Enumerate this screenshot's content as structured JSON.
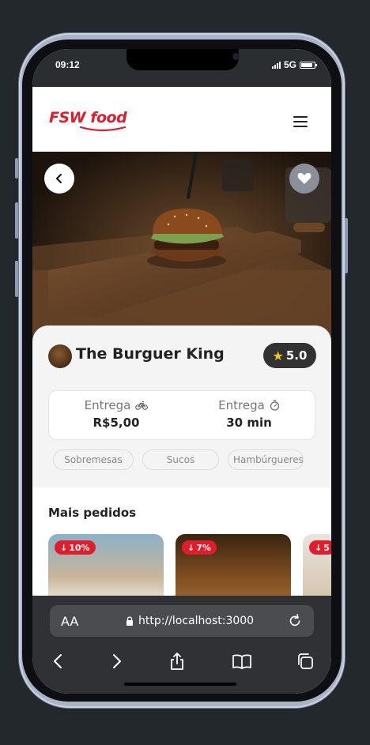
{
  "status": {
    "time": "09:12",
    "network": "5G"
  },
  "header": {
    "logo": "FSW food"
  },
  "restaurant": {
    "name": "The Burguer King",
    "rating": "5.0"
  },
  "delivery": {
    "fee_label": "Entrega",
    "fee_value": "R$5,00",
    "time_label": "Entrega",
    "time_value": "30 min"
  },
  "categories": [
    "Sobremesas",
    "Sucos",
    "Hambúrgueres"
  ],
  "section": {
    "title": "Mais pedidos"
  },
  "products": [
    {
      "discount": "10%"
    },
    {
      "discount": "7%"
    },
    {
      "discount": "5"
    }
  ],
  "browser": {
    "aa": "AA",
    "url": "http://localhost:3000"
  },
  "colors": {
    "brand": "#e11d2c",
    "rating_bg": "#323232",
    "browser_bg": "#2f3134"
  }
}
